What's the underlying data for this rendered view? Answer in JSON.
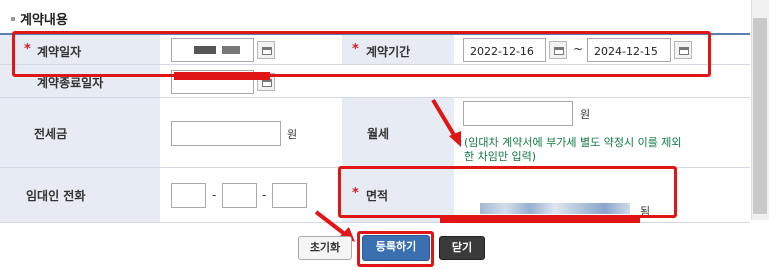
{
  "section": {
    "title": "계약내용"
  },
  "rows": {
    "contract_date": {
      "required": "*",
      "label": "계약일자"
    },
    "contract_period": {
      "required": "*",
      "label": "계약기간",
      "start": "2022-12-16",
      "separator": "~",
      "end": "2024-12-15"
    },
    "contract_end": {
      "label": "계약종료일자"
    },
    "deposit": {
      "label": "전세금",
      "unit": "원"
    },
    "monthly_rent": {
      "label": "월세",
      "unit": "원",
      "note": "(임대차 계약서에 부가세 별도 약정시 이를 제외한 차임만 입력)"
    },
    "landlord_phone": {
      "label": "임대인 전화",
      "sep1": "-",
      "sep2": "-"
    },
    "area": {
      "required": "*",
      "label": "면적",
      "unit": "됨"
    }
  },
  "buttons": {
    "reset": "초기화",
    "submit": "등록하기",
    "close": "닫기"
  },
  "colors": {
    "accent": "#3a6fb0",
    "label_bg": "#e7ebf4",
    "annotation": "#e01515",
    "note": "#117a44"
  },
  "icons": [
    "calendar-icon",
    "red-arrow-icon"
  ]
}
